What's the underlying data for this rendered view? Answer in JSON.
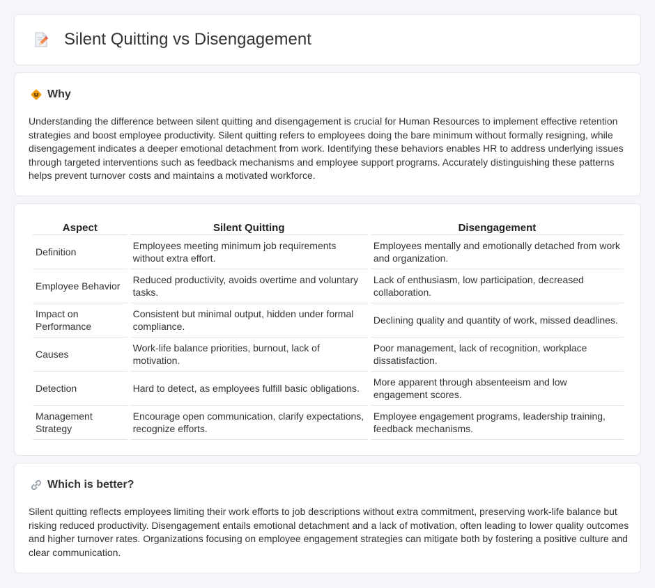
{
  "header": {
    "title": "Silent Quitting vs Disengagement",
    "icon": "document-pencil-icon"
  },
  "why": {
    "title": "Why",
    "icon": "diamond-sign-icon",
    "text": "Understanding the difference between silent quitting and disengagement is crucial for Human Resources to implement effective retention strategies and boost employee productivity. Silent quitting refers to employees doing the bare minimum without formally resigning, while disengagement indicates a deeper emotional detachment from work. Identifying these behaviors enables HR to address underlying issues through targeted interventions such as feedback mechanisms and employee support programs. Accurately distinguishing these patterns helps prevent turnover costs and maintains a motivated workforce."
  },
  "table": {
    "headers": [
      "Aspect",
      "Silent Quitting",
      "Disengagement"
    ],
    "rows": [
      [
        "Definition",
        "Employees meeting minimum job requirements without extra effort.",
        "Employees mentally and emotionally detached from work and organization."
      ],
      [
        "Employee Behavior",
        "Reduced productivity, avoids overtime and voluntary tasks.",
        "Lack of enthusiasm, low participation, decreased collaboration."
      ],
      [
        "Impact on Performance",
        "Consistent but minimal output, hidden under formal compliance.",
        "Declining quality and quantity of work, missed deadlines."
      ],
      [
        "Causes",
        "Work-life balance priorities, burnout, lack of motivation.",
        "Poor management, lack of recognition, workplace dissatisfaction."
      ],
      [
        "Detection",
        "Hard to detect, as employees fulfill basic obligations.",
        "More apparent through absenteeism and low engagement scores."
      ],
      [
        "Management Strategy",
        "Encourage open communication, clarify expectations, recognize efforts.",
        "Employee engagement programs, leadership training, feedback mechanisms."
      ]
    ]
  },
  "better": {
    "title": "Which is better?",
    "icon": "link-icon",
    "text": "Silent quitting reflects employees limiting their work efforts to job descriptions without extra commitment, preserving work-life balance but risking reduced productivity. Disengagement entails emotional detachment and a lack of motivation, often leading to lower quality outcomes and higher turnover rates. Organizations focusing on employee engagement strategies can mitigate both by fostering a positive culture and clear communication."
  },
  "colors": {
    "page_bg": "#f5f6fa",
    "card_bg": "#ffffff",
    "accent_orange": "#f39c12"
  }
}
